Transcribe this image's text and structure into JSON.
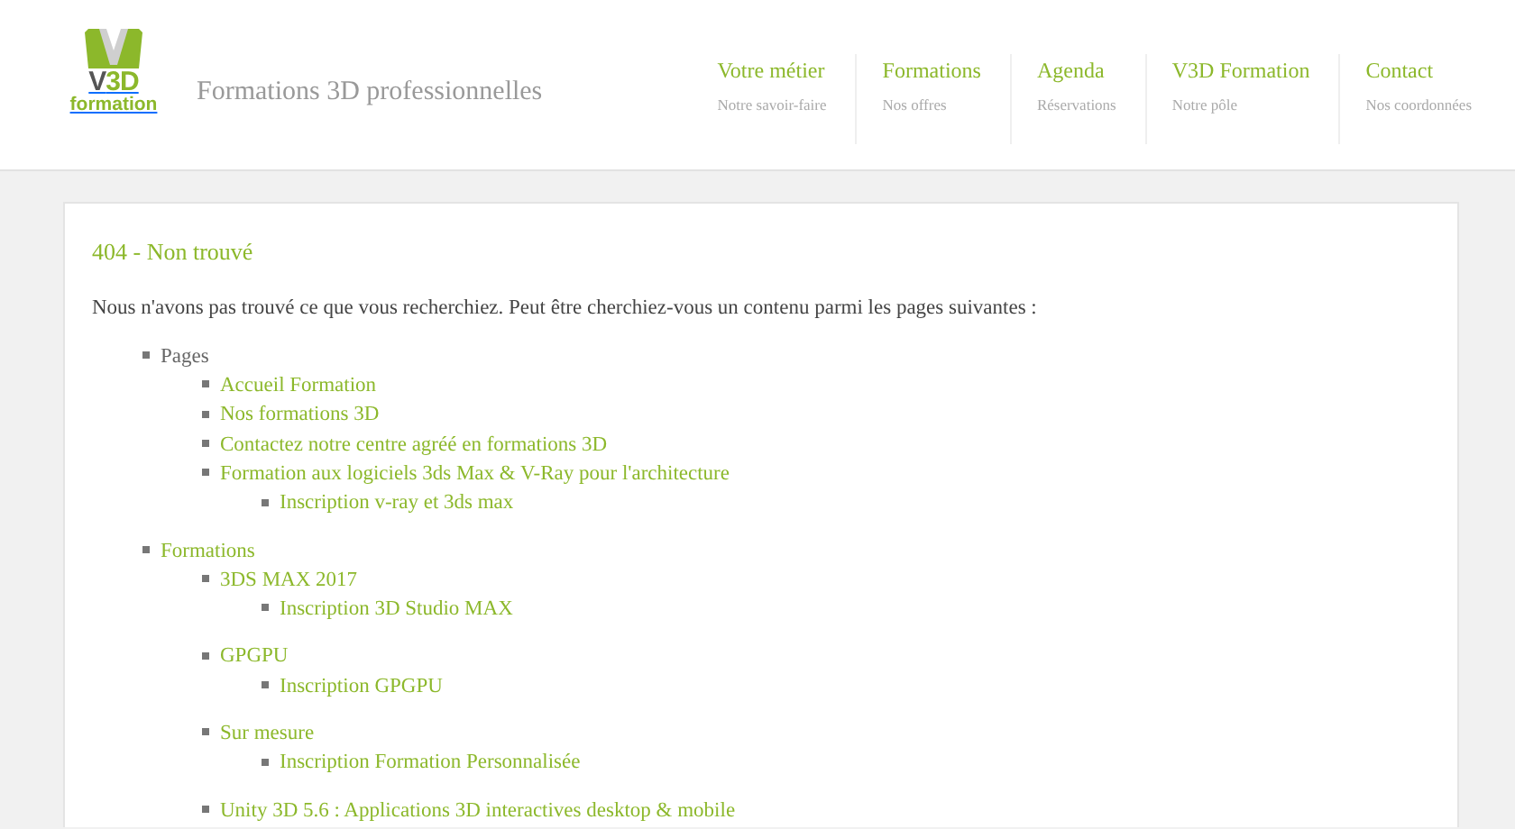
{
  "header": {
    "logo": {
      "letters": [
        "V",
        "3D"
      ],
      "word": "formation"
    },
    "tagline": "Formations 3D professionnelles",
    "nav": [
      {
        "label": "Votre métier",
        "sub": "Notre savoir-faire"
      },
      {
        "label": "Formations",
        "sub": "Nos offres"
      },
      {
        "label": "Agenda",
        "sub": "Réservations"
      },
      {
        "label": "V3D Formation",
        "sub": "Notre pôle"
      },
      {
        "label": "Contact",
        "sub": "Nos coordonnées"
      }
    ]
  },
  "content": {
    "title": "404 - Non trouvé",
    "message": "Nous n'avons pas trouvé ce que vous recherchiez. Peut être cherchiez-vous un contenu parmi les pages suivantes :",
    "sitemap": [
      {
        "label": "Pages",
        "link": false,
        "children": [
          {
            "label": "Accueil Formation",
            "link": true
          },
          {
            "label": "Nos formations 3D",
            "link": true
          },
          {
            "label": "Contactez notre centre agréé en formations 3D",
            "link": true
          },
          {
            "label": "Formation aux logiciels 3ds Max & V-Ray pour l'architecture",
            "link": true,
            "children": [
              {
                "label": "Inscription v-ray et 3ds max",
                "link": true
              }
            ]
          }
        ]
      },
      {
        "label": "Formations",
        "link": true,
        "children": [
          {
            "label": "3DS MAX 2017",
            "link": true,
            "children": [
              {
                "label": "Inscription 3D Studio MAX",
                "link": true
              }
            ]
          },
          {
            "label": "GPGPU",
            "link": true,
            "children": [
              {
                "label": "Inscription GPGPU",
                "link": true
              }
            ]
          },
          {
            "label": "Sur mesure",
            "link": true,
            "children": [
              {
                "label": "Inscription Formation Personnalisée",
                "link": true
              }
            ]
          },
          {
            "label": "Unity 3D 5.6 : Applications 3D interactives desktop & mobile",
            "link": true
          }
        ]
      }
    ]
  }
}
